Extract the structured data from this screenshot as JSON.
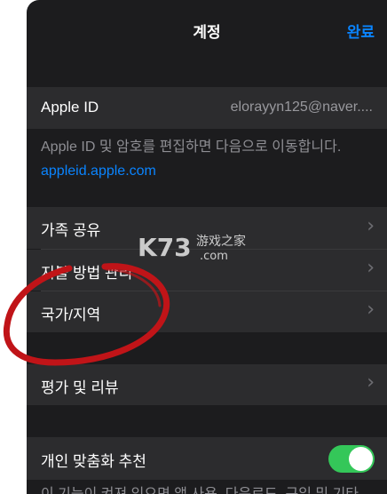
{
  "nav": {
    "title": "계정",
    "done_label": "완료"
  },
  "apple_id": {
    "label": "Apple ID",
    "value": "elorayyn125@naver....",
    "footer_text": "Apple ID 및 암호를 편집하면 다음으로 이동합니다.",
    "footer_link": "appleid.apple.com"
  },
  "menu_group": [
    {
      "label": "가족 공유"
    },
    {
      "label": "지불 방법 관리"
    },
    {
      "label": "국가/지역"
    }
  ],
  "ratings": {
    "label": "평가 및 리뷰"
  },
  "personalization": {
    "label": "개인 맞춤화 추천",
    "toggle_on": true,
    "footer_text": "이 기능이 켜져 있으면 앱 사용, 다운로드, 구입 및 기타"
  },
  "watermark": {
    "brand": "K73",
    "text": "游戏之家",
    "domain": ".com"
  },
  "icons": {
    "chevron": "chevron-right-icon"
  },
  "colors": {
    "accent": "#0a84ff",
    "toggle_on": "#34c759",
    "annotation": "#c01418"
  }
}
